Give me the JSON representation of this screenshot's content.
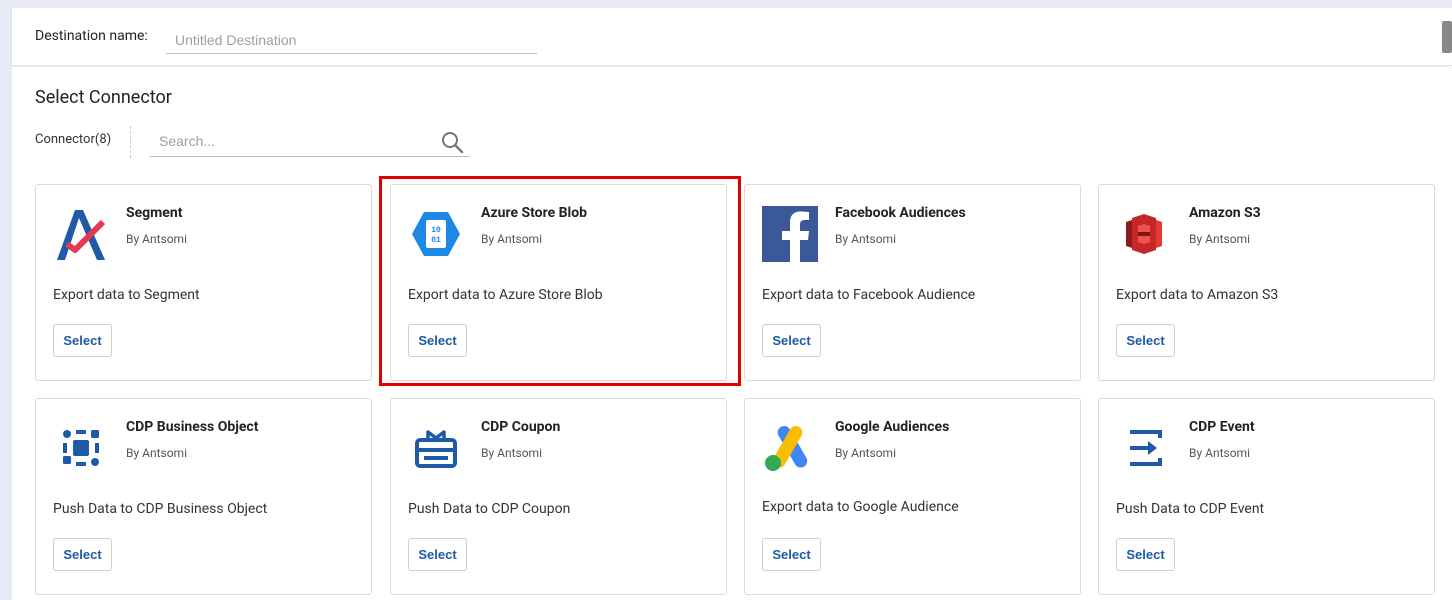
{
  "destination": {
    "label": "Destination name:",
    "placeholder": "Untitled Destination",
    "value": ""
  },
  "section_title": "Select Connector",
  "connector_count": "Connector(8)",
  "search": {
    "placeholder": "Search..."
  },
  "select_label": "Select",
  "highlight_color": "#e00000",
  "connectors": [
    {
      "name": "Segment",
      "by": "By Antsomi",
      "desc": "Export data to Segment",
      "icon": "segment-logo"
    },
    {
      "name": "Azure Store Blob",
      "by": "By Antsomi",
      "desc": "Export data to Azure Store Blob",
      "icon": "azure-blob-logo"
    },
    {
      "name": "Facebook Audiences",
      "by": "By Antsomi",
      "desc": "Export data to Facebook Audience",
      "icon": "facebook-logo"
    },
    {
      "name": "Amazon S3",
      "by": "By Antsomi",
      "desc": "Export data to Amazon S3",
      "icon": "amazon-s3-logo"
    },
    {
      "name": "CDP Business Object",
      "by": "By Antsomi",
      "desc": "Push Data to CDP Business Object",
      "icon": "business-object-icon"
    },
    {
      "name": "CDP Coupon",
      "by": "By Antsomi",
      "desc": "Push Data to CDP Coupon",
      "icon": "coupon-icon"
    },
    {
      "name": "Google Audiences",
      "by": "By Antsomi",
      "desc": "Export data to Google Audience",
      "icon": "google-ads-logo"
    },
    {
      "name": "CDP Event",
      "by": "By Antsomi",
      "desc": "Push Data to CDP Event",
      "icon": "event-icon"
    }
  ]
}
